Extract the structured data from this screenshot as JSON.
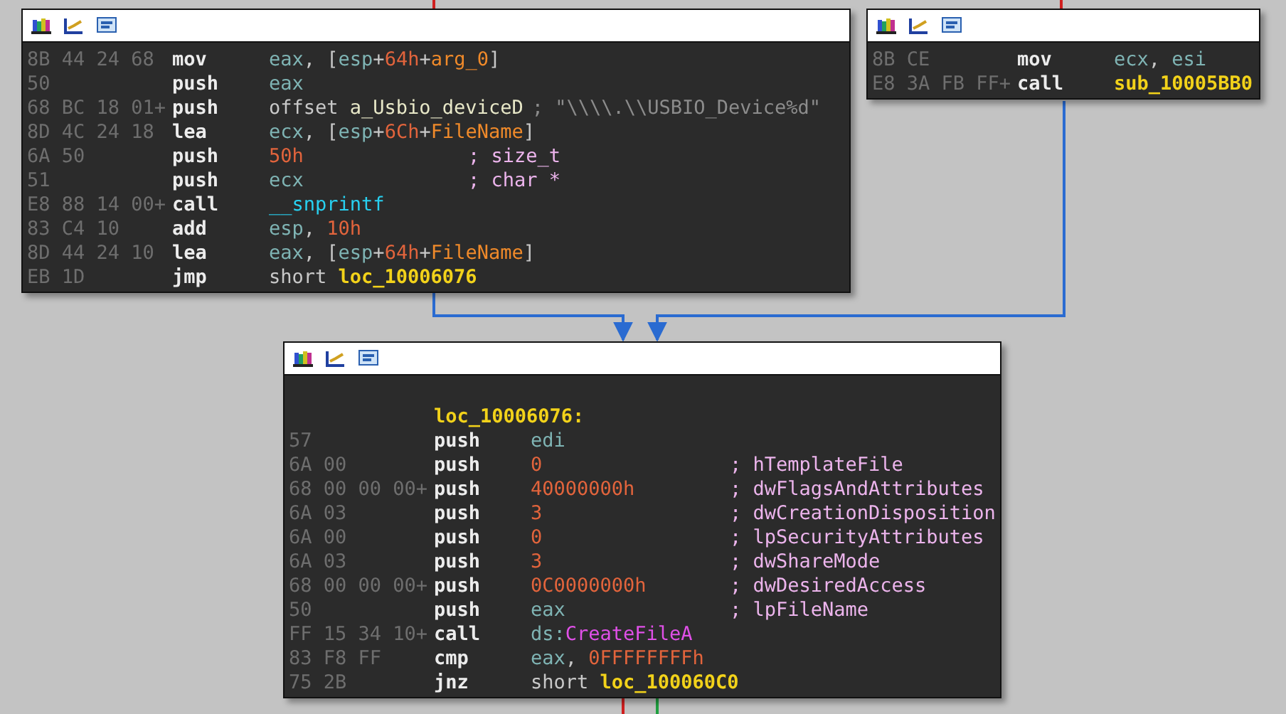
{
  "blocks": [
    {
      "lines": [
        {
          "bytes": "8B 44 24 68",
          "mnemonic": "mov",
          "operand": [
            {
              "kind": "reg",
              "text": "eax"
            },
            {
              "kind": "plain",
              "text": ", ["
            },
            {
              "kind": "reg",
              "text": "esp"
            },
            {
              "kind": "plain",
              "text": "+"
            },
            {
              "kind": "num",
              "text": "64h"
            },
            {
              "kind": "plain",
              "text": "+"
            },
            {
              "kind": "var",
              "text": "arg_0"
            },
            {
              "kind": "plain",
              "text": "]"
            }
          ]
        },
        {
          "bytes": "50",
          "mnemonic": "push",
          "operand": [
            {
              "kind": "reg",
              "text": "eax"
            }
          ]
        },
        {
          "bytes": "68 BC 18 01+",
          "mnemonic": "push",
          "operand": [
            {
              "kind": "plain",
              "text": "offset "
            },
            {
              "kind": "data",
              "text": "a_Usbio_deviceD"
            }
          ],
          "comment": {
            "kind": "string",
            "text": "; \"\\\\\\\\.\\\\USBIO_Device%d\""
          }
        },
        {
          "bytes": "8D 4C 24 18",
          "mnemonic": "lea",
          "operand": [
            {
              "kind": "reg",
              "text": "ecx"
            },
            {
              "kind": "plain",
              "text": ", ["
            },
            {
              "kind": "reg",
              "text": "esp"
            },
            {
              "kind": "plain",
              "text": "+"
            },
            {
              "kind": "num",
              "text": "6Ch"
            },
            {
              "kind": "plain",
              "text": "+"
            },
            {
              "kind": "var",
              "text": "FileName"
            },
            {
              "kind": "plain",
              "text": "]"
            }
          ]
        },
        {
          "bytes": "6A 50",
          "mnemonic": "push",
          "operand": [
            {
              "kind": "num",
              "text": "50h"
            }
          ],
          "comment": {
            "kind": "type",
            "text": "; size_t"
          }
        },
        {
          "bytes": "51",
          "mnemonic": "push",
          "operand": [
            {
              "kind": "reg",
              "text": "ecx"
            }
          ],
          "comment": {
            "kind": "type",
            "text": "; char *"
          }
        },
        {
          "bytes": "E8 88 14 00+",
          "mnemonic": "call",
          "operand": [
            {
              "kind": "func",
              "text": "__snprintf"
            }
          ]
        },
        {
          "bytes": "83 C4 10",
          "mnemonic": "add",
          "operand": [
            {
              "kind": "reg",
              "text": "esp"
            },
            {
              "kind": "plain",
              "text": ", "
            },
            {
              "kind": "num",
              "text": "10h"
            }
          ]
        },
        {
          "bytes": "8D 44 24 10",
          "mnemonic": "lea",
          "operand": [
            {
              "kind": "reg",
              "text": "eax"
            },
            {
              "kind": "plain",
              "text": ", ["
            },
            {
              "kind": "reg",
              "text": "esp"
            },
            {
              "kind": "plain",
              "text": "+"
            },
            {
              "kind": "num",
              "text": "64h"
            },
            {
              "kind": "plain",
              "text": "+"
            },
            {
              "kind": "var",
              "text": "FileName"
            },
            {
              "kind": "plain",
              "text": "]"
            }
          ]
        },
        {
          "bytes": "EB 1D",
          "mnemonic": "jmp",
          "operand": [
            {
              "kind": "plain",
              "text": "short "
            },
            {
              "kind": "label",
              "text": "loc_10006076"
            }
          ]
        }
      ]
    },
    {
      "lines": [
        {
          "bytes": "8B CE",
          "mnemonic": "mov",
          "operand": [
            {
              "kind": "reg",
              "text": "ecx"
            },
            {
              "kind": "plain",
              "text": ", "
            },
            {
              "kind": "reg",
              "text": "esi"
            }
          ]
        },
        {
          "bytes": "E8 3A FB FF+",
          "mnemonic": "call",
          "operand": [
            {
              "kind": "label",
              "text": "sub_10005BB0"
            }
          ]
        }
      ]
    },
    {
      "label": "loc_10006076:",
      "lines": [
        {
          "bytes": "57",
          "mnemonic": "push",
          "operand": [
            {
              "kind": "reg",
              "text": "edi"
            }
          ]
        },
        {
          "bytes": "6A 00",
          "mnemonic": "push",
          "operand": [
            {
              "kind": "num",
              "text": "0"
            }
          ],
          "comment": {
            "kind": "type",
            "text": "; hTemplateFile"
          }
        },
        {
          "bytes": "68 00 00 00+",
          "mnemonic": "push",
          "operand": [
            {
              "kind": "num",
              "text": "40000000h"
            }
          ],
          "comment": {
            "kind": "type",
            "text": "; dwFlagsAndAttributes"
          }
        },
        {
          "bytes": "6A 03",
          "mnemonic": "push",
          "operand": [
            {
              "kind": "num",
              "text": "3"
            }
          ],
          "comment": {
            "kind": "type",
            "text": "; dwCreationDisposition"
          }
        },
        {
          "bytes": "6A 00",
          "mnemonic": "push",
          "operand": [
            {
              "kind": "num",
              "text": "0"
            }
          ],
          "comment": {
            "kind": "type",
            "text": "; lpSecurityAttributes"
          }
        },
        {
          "bytes": "6A 03",
          "mnemonic": "push",
          "operand": [
            {
              "kind": "num",
              "text": "3"
            }
          ],
          "comment": {
            "kind": "type",
            "text": "; dwShareMode"
          }
        },
        {
          "bytes": "68 00 00 00+",
          "mnemonic": "push",
          "operand": [
            {
              "kind": "num",
              "text": "0C0000000h"
            }
          ],
          "comment": {
            "kind": "type",
            "text": "; dwDesiredAccess"
          }
        },
        {
          "bytes": "50",
          "mnemonic": "push",
          "operand": [
            {
              "kind": "reg",
              "text": "eax"
            }
          ],
          "comment": {
            "kind": "type",
            "text": "; lpFileName"
          }
        },
        {
          "bytes": "FF 15 34 10+",
          "mnemonic": "call",
          "operand": [
            {
              "kind": "reg",
              "text": "ds:"
            },
            {
              "kind": "import",
              "text": "CreateFileA"
            }
          ]
        },
        {
          "bytes": "83 F8 FF",
          "mnemonic": "cmp",
          "operand": [
            {
              "kind": "reg",
              "text": "eax"
            },
            {
              "kind": "plain",
              "text": ", "
            },
            {
              "kind": "num",
              "text": "0FFFFFFFFh"
            }
          ]
        },
        {
          "bytes": "75 2B",
          "mnemonic": "jnz",
          "operand": [
            {
              "kind": "plain",
              "text": "short "
            },
            {
              "kind": "label",
              "text": "loc_100060C0"
            }
          ]
        }
      ]
    }
  ]
}
